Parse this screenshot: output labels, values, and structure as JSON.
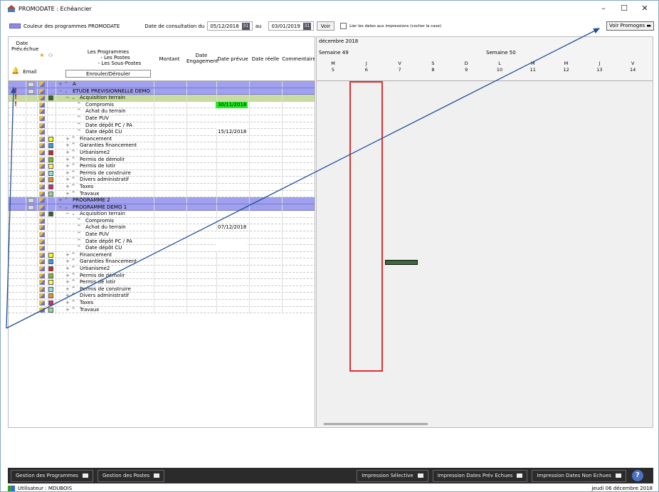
{
  "window": {
    "title": "PROMODATE : Echéancier",
    "minimize": "–",
    "maximize": "☐",
    "close": "✕"
  },
  "toolbar": {
    "legend_label": "Couleur des programmes PROMODATE",
    "date_label": "Date de consultation du",
    "date_from": "05/12/2018",
    "au_label": "au",
    "date_to": "03/01/2019",
    "cal_glyph": "31",
    "voir_label": "Voir",
    "link_label": "Lier les dates aux impressions (cocher la case)",
    "voir_promoges_label": "Voir Promoges"
  },
  "grid": {
    "headers": {
      "date_prev": "Date Prév.échue",
      "email": "Email",
      "programmes": "Les Programmes",
      "postes": "- Les Postes",
      "sous_postes": "- Les Sous-Postes",
      "enrouler": "Enrouler/Dérouler",
      "montant": "Montant",
      "date_eng": "Date Engagement",
      "date_prevue": "Date prévue",
      "date_reelle": "Date réelle",
      "commentaire": "Commentaire"
    },
    "rows": [
      {
        "label": "A",
        "prefix": "+ ^",
        "level": 0,
        "kind": "sel",
        "excl": false,
        "badge": true,
        "color": "",
        "date": "",
        "datestyle": ""
      },
      {
        "label": "ETUDE PREVISIONNELLE DEMO",
        "prefix": "− ⌄",
        "level": 0,
        "kind": "sel",
        "excl": true,
        "badge": true,
        "color": "",
        "date": "",
        "datestyle": ""
      },
      {
        "label": "Acquisition terrain",
        "prefix": "− ⌄",
        "level": 1,
        "kind": "acq",
        "excl": true,
        "badge": false,
        "color": "#2a6a2a",
        "date": "",
        "datestyle": ""
      },
      {
        "label": "Compromis",
        "prefix": "^",
        "level": 2,
        "kind": "",
        "excl": true,
        "badge": false,
        "color": "",
        "date": "30/11/2018",
        "datestyle": "green"
      },
      {
        "label": "Achat du terrain",
        "prefix": "^",
        "level": 2,
        "kind": "",
        "excl": false,
        "badge": false,
        "color": "",
        "date": "",
        "datestyle": "white"
      },
      {
        "label": "Date PUV",
        "prefix": "^",
        "level": 2,
        "kind": "",
        "excl": false,
        "badge": false,
        "color": "",
        "date": "",
        "datestyle": "white"
      },
      {
        "label": "Date dépôt PC / PA",
        "prefix": "^",
        "level": 2,
        "kind": "",
        "excl": false,
        "badge": false,
        "color": "",
        "date": "",
        "datestyle": "white"
      },
      {
        "label": "Date dépôt CU",
        "prefix": "^",
        "level": 2,
        "kind": "",
        "excl": false,
        "badge": false,
        "color": "",
        "date": "15/12/2018",
        "datestyle": ""
      },
      {
        "label": "Financement",
        "prefix": "+ ^",
        "level": 1,
        "kind": "",
        "excl": false,
        "badge": false,
        "color": "#ffff00",
        "date": "",
        "datestyle": ""
      },
      {
        "label": "Garanties financement",
        "prefix": "+ ^",
        "level": 1,
        "kind": "",
        "excl": false,
        "badge": false,
        "color": "#3a9ae0",
        "date": "",
        "datestyle": ""
      },
      {
        "label": "Urbanisme2",
        "prefix": "+ ^",
        "level": 1,
        "kind": "",
        "excl": false,
        "badge": false,
        "color": "#e02020",
        "date": "",
        "datestyle": ""
      },
      {
        "label": "Permis de démolir",
        "prefix": "+ ^",
        "level": 1,
        "kind": "",
        "excl": false,
        "badge": false,
        "color": "#80c020",
        "date": "",
        "datestyle": ""
      },
      {
        "label": "Permis de lotir",
        "prefix": "+ ^",
        "level": 1,
        "kind": "",
        "excl": false,
        "badge": false,
        "color": "#ffff40",
        "date": "",
        "datestyle": ""
      },
      {
        "label": "Permis de construire",
        "prefix": "+ ^",
        "level": 1,
        "kind": "",
        "excl": false,
        "badge": false,
        "color": "#90e0e0",
        "date": "",
        "datestyle": ""
      },
      {
        "label": "Divers administratif",
        "prefix": "+ ^",
        "level": 1,
        "kind": "",
        "excl": false,
        "badge": false,
        "color": "#f09020",
        "date": "",
        "datestyle": ""
      },
      {
        "label": "Taxes",
        "prefix": "+ ^",
        "level": 1,
        "kind": "",
        "excl": false,
        "badge": false,
        "color": "#e02080",
        "date": "",
        "datestyle": ""
      },
      {
        "label": "Travaux",
        "prefix": "+ ^",
        "level": 1,
        "kind": "",
        "excl": false,
        "badge": false,
        "color": "#90e090",
        "date": "",
        "datestyle": ""
      },
      {
        "label": "PROGRAMME 2",
        "prefix": "+ ^",
        "level": 0,
        "kind": "sel",
        "excl": false,
        "badge": true,
        "color": "",
        "date": "",
        "datestyle": ""
      },
      {
        "label": "PROGRAMME DEMO 1",
        "prefix": "− ⌄",
        "level": 0,
        "kind": "sel",
        "excl": false,
        "badge": true,
        "color": "",
        "date": "",
        "datestyle": ""
      },
      {
        "label": "Acquisition terrain",
        "prefix": "− ⌄",
        "level": 1,
        "kind": "",
        "excl": false,
        "badge": false,
        "color": "#2a6a2a",
        "date": "",
        "datestyle": ""
      },
      {
        "label": "Compromis",
        "prefix": "^",
        "level": 2,
        "kind": "",
        "excl": false,
        "badge": false,
        "color": "",
        "date": "",
        "datestyle": ""
      },
      {
        "label": "Achat du terrain",
        "prefix": "^",
        "level": 2,
        "kind": "",
        "excl": false,
        "badge": false,
        "color": "",
        "date": "07/12/2018",
        "datestyle": ""
      },
      {
        "label": "Date PUV",
        "prefix": "^",
        "level": 2,
        "kind": "",
        "excl": false,
        "badge": false,
        "color": "",
        "date": "",
        "datestyle": "white"
      },
      {
        "label": "Date dépôt PC / PA",
        "prefix": "^",
        "level": 2,
        "kind": "",
        "excl": false,
        "badge": false,
        "color": "",
        "date": "",
        "datestyle": "white"
      },
      {
        "label": "Date dépôt CU",
        "prefix": "^",
        "level": 2,
        "kind": "",
        "excl": false,
        "badge": false,
        "color": "",
        "date": "",
        "datestyle": "white"
      },
      {
        "label": "Financement",
        "prefix": "+ ^",
        "level": 1,
        "kind": "",
        "excl": false,
        "badge": false,
        "color": "#ffff00",
        "date": "",
        "datestyle": ""
      },
      {
        "label": "Garanties financement",
        "prefix": "+ ^",
        "level": 1,
        "kind": "",
        "excl": false,
        "badge": false,
        "color": "#3a9ae0",
        "date": "",
        "datestyle": ""
      },
      {
        "label": "Urbanisme2",
        "prefix": "+ ^",
        "level": 1,
        "kind": "",
        "excl": false,
        "badge": false,
        "color": "#e02020",
        "date": "",
        "datestyle": ""
      },
      {
        "label": "Permis de démolir",
        "prefix": "+ ^",
        "level": 1,
        "kind": "",
        "excl": false,
        "badge": false,
        "color": "#80c020",
        "date": "",
        "datestyle": ""
      },
      {
        "label": "Permis de lotir",
        "prefix": "+ ^",
        "level": 1,
        "kind": "",
        "excl": false,
        "badge": false,
        "color": "#ffff40",
        "date": "",
        "datestyle": ""
      },
      {
        "label": "Permis de construire",
        "prefix": "+ ^",
        "level": 1,
        "kind": "",
        "excl": false,
        "badge": false,
        "color": "#90e0e0",
        "date": "",
        "datestyle": ""
      },
      {
        "label": "Divers administratif",
        "prefix": "+ ^",
        "level": 1,
        "kind": "",
        "excl": false,
        "badge": false,
        "color": "#f09020",
        "date": "",
        "datestyle": ""
      },
      {
        "label": "Taxes",
        "prefix": "+ ^",
        "level": 1,
        "kind": "",
        "excl": false,
        "badge": false,
        "color": "#e02080",
        "date": "",
        "datestyle": ""
      },
      {
        "label": "Travaux",
        "prefix": "+ ^",
        "level": 1,
        "kind": "",
        "excl": false,
        "badge": false,
        "color": "#90e090",
        "date": "",
        "datestyle": ""
      }
    ]
  },
  "gantt": {
    "month": "décembre 2018",
    "week1": "Semaine 49",
    "week2": "Semaine 50",
    "days": [
      {
        "l": "M",
        "n": "5"
      },
      {
        "l": "J",
        "n": "6"
      },
      {
        "l": "V",
        "n": "7"
      },
      {
        "l": "S",
        "n": "8"
      },
      {
        "l": "D",
        "n": "9"
      },
      {
        "l": "L",
        "n": "10"
      },
      {
        "l": "M",
        "n": "11"
      },
      {
        "l": "M",
        "n": "12"
      },
      {
        "l": "J",
        "n": "13"
      },
      {
        "l": "V",
        "n": "14"
      }
    ]
  },
  "bottom": {
    "gestion_programmes": "Gestion des Programmes",
    "gestion_postes": "Gestion des Postes",
    "impression_selective": "Impression Sélective",
    "impression_prev_echues": "Impression Dates Prév Echues",
    "impression_non_echues": "Impression Dates Non Echues",
    "help": "?"
  },
  "status": {
    "user": "Utilisateur : MDUBOIS",
    "date": "jeudi 06 décembre 2018"
  },
  "colors": {
    "programme_row": "#a0a0ee",
    "acquisition_row": "#c8dca0",
    "today_box": "#e03030",
    "arrow": "#1f4e9a"
  }
}
